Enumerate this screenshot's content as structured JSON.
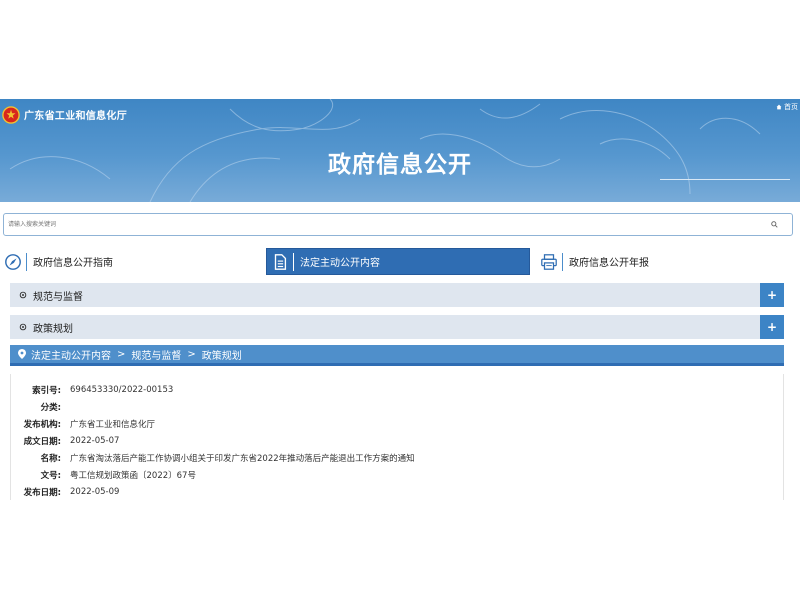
{
  "header": {
    "site_name": "广东省工业和信息化厅",
    "home_label": "首页",
    "title": "政府信息公开"
  },
  "search": {
    "placeholder": "请输入搜索关键词"
  },
  "tabs": [
    {
      "label": "政府信息公开指南",
      "icon": "compass-icon",
      "active": false
    },
    {
      "label": "法定主动公开内容",
      "icon": "document-icon",
      "active": true
    },
    {
      "label": "政府信息公开年报",
      "icon": "printer-icon",
      "active": false
    }
  ],
  "panels": [
    {
      "label": "规范与监督",
      "button": "+"
    },
    {
      "label": "政策规划",
      "button": "+"
    }
  ],
  "breadcrumb": {
    "items": [
      "法定主动公开内容",
      "规范与监督",
      "政策规划"
    ],
    "separator": ">"
  },
  "meta": [
    {
      "label": "索引号:",
      "value": "696453330/2022-00153"
    },
    {
      "label": "分类:",
      "value": ""
    },
    {
      "label": "发布机构:",
      "value": "广东省工业和信息化厅"
    },
    {
      "label": "成文日期:",
      "value": "2022-05-07"
    },
    {
      "label": "名称:",
      "value": "广东省淘汰落后产能工作协调小组关于印发广东省2022年推动落后产能退出工作方案的通知"
    },
    {
      "label": "文号:",
      "value": "粤工信规划政策函〔2022〕67号"
    },
    {
      "label": "发布日期:",
      "value": "2022-05-09"
    }
  ],
  "colors": {
    "banner": "#4a8ecb",
    "active_tab": "#2f6db3",
    "panel_bg": "#dfe6ef",
    "plus_button": "#3c84c6",
    "breadcrumb_bg": "#4f8fcb"
  }
}
